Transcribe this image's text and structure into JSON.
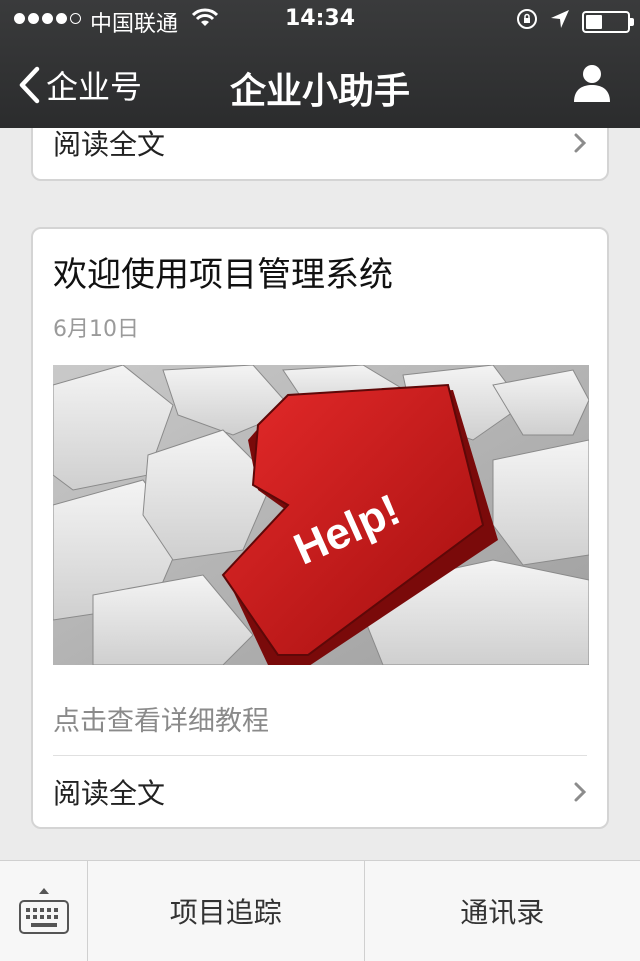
{
  "status": {
    "carrier": "中国联通",
    "time": "14:34",
    "signal_bars_filled": 4,
    "signal_bars_total": 5,
    "battery_level": 0.4
  },
  "nav": {
    "back_label": "企业号",
    "title": "企业小助手"
  },
  "articles": [
    {
      "read_more_label": "阅读全文"
    },
    {
      "title": "欢迎使用项目管理系统",
      "date": "6月10日",
      "image_text": "Help!",
      "summary": "点击查看详细教程",
      "read_more_label": "阅读全文"
    }
  ],
  "tabbar": {
    "items": [
      "项目追踪",
      "通讯录"
    ]
  },
  "icons": {
    "back": "chevron-left-icon",
    "profile": "person-icon",
    "wifi": "wifi-icon",
    "lock_rotation": "rotation-lock-icon",
    "location": "location-arrow-icon",
    "battery": "battery-icon",
    "keyboard": "keyboard-icon",
    "chevron": "chevron-right-icon"
  },
  "colors": {
    "header": "#2f3031",
    "background": "#ebebeb",
    "help_key": "#d01a1a"
  }
}
